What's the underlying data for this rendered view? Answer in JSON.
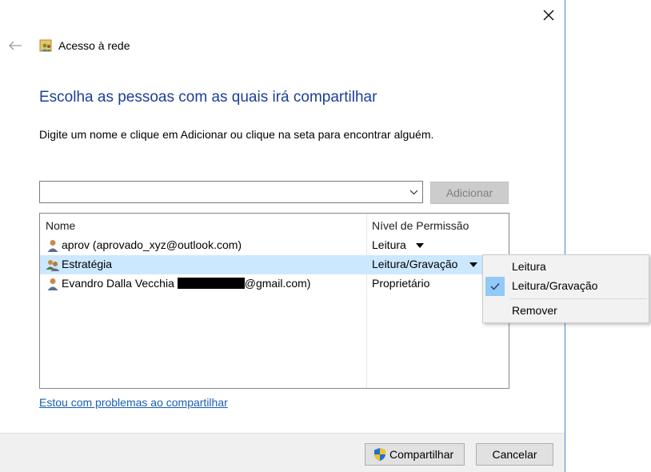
{
  "window": {
    "title": "Acesso à rede"
  },
  "heading": "Escolha as pessoas com as quais irá compartilhar",
  "instructions": "Digite um nome e clique em Adicionar ou clique na seta para encontrar alguém.",
  "name_input": {
    "value": "",
    "placeholder": ""
  },
  "add_button": "Adicionar",
  "list": {
    "columns": {
      "name": "Nome",
      "permission": "Nível de Permissão"
    },
    "rows": [
      {
        "name": "aprov (aprovado_xyz@outlook.com)",
        "permission": "Leitura",
        "icon": "user-icon",
        "selected": false
      },
      {
        "name": "Estratégia",
        "permission": "Leitura/Gravação",
        "icon": "group-icon",
        "selected": true
      },
      {
        "name_prefix": "Evandro Dalla Vecchia",
        "name_suffix": "@gmail.com)",
        "permission": "Proprietário",
        "icon": "user-icon",
        "selected": false
      }
    ]
  },
  "help_link": "Estou com problemas ao compartilhar",
  "footer": {
    "share_button": "Compartilhar",
    "cancel_button": "Cancelar"
  },
  "context_menu": {
    "items": [
      {
        "label": "Leitura",
        "checked": false
      },
      {
        "label": "Leitura/Gravação",
        "checked": true
      },
      {
        "label": "Remover",
        "checked": false
      }
    ]
  },
  "colors": {
    "heading": "#1b3f9a",
    "link": "#1a5fb4",
    "selection": "#cce8ff",
    "menu_check": "#91c9f7",
    "window_border": "#4a88c8"
  }
}
